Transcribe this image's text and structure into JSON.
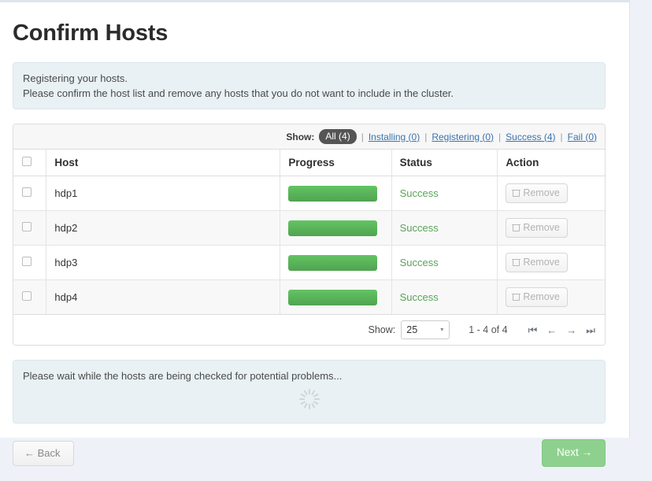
{
  "page": {
    "title": "Confirm Hosts"
  },
  "info_alert": {
    "line1": "Registering your hosts.",
    "line2": "Please confirm the host list and remove any hosts that you do not want to include in the cluster."
  },
  "filter_bar": {
    "show_label": "Show:",
    "separator": "|",
    "items": [
      {
        "label": "All (4)",
        "active": true
      },
      {
        "label": "Installing (0)",
        "active": false
      },
      {
        "label": "Registering (0)",
        "active": false
      },
      {
        "label": "Success (4)",
        "active": false
      },
      {
        "label": "Fail (0)",
        "active": false
      }
    ]
  },
  "table": {
    "columns": [
      "",
      "Host",
      "Progress",
      "Status",
      "Action"
    ],
    "rows": [
      {
        "host": "hdp1",
        "progress": 100,
        "status": "Success",
        "action": "Remove"
      },
      {
        "host": "hdp2",
        "progress": 100,
        "status": "Success",
        "action": "Remove"
      },
      {
        "host": "hdp3",
        "progress": 100,
        "status": "Success",
        "action": "Remove"
      },
      {
        "host": "hdp4",
        "progress": 100,
        "status": "Success",
        "action": "Remove"
      }
    ]
  },
  "pagination": {
    "show_label": "Show:",
    "page_size": "25",
    "caret": "▾",
    "range": "1 - 4 of 4",
    "first": "⏮",
    "prev": "←",
    "next": "→",
    "last": "⏭"
  },
  "wait_box": {
    "text": "Please wait while the hosts are being checked for potential problems...",
    "spinner": "loading-spinner"
  },
  "footer": {
    "back_label": "←  Back",
    "next_label": "Next  →"
  },
  "colors": {
    "accent_green": "#51a351",
    "status_success": "#5aa35a",
    "link_blue": "#3b73af",
    "badge_dark": "#555555",
    "info_bg": "#e9f1f5",
    "next_button": "#8ed18e"
  }
}
